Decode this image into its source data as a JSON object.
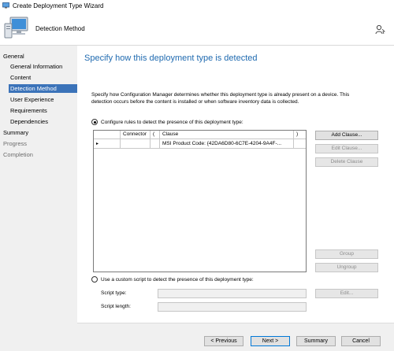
{
  "window": {
    "title": "Create Deployment Type Wizard"
  },
  "header": {
    "title": "Detection Method"
  },
  "nav": {
    "general": "General",
    "general_information": "General Information",
    "content": "Content",
    "detection_method": "Detection Method",
    "user_experience": "User Experience",
    "requirements": "Requirements",
    "dependencies": "Dependencies",
    "summary": "Summary",
    "progress": "Progress",
    "completion": "Completion"
  },
  "main": {
    "heading": "Specify how this deployment type is detected",
    "description": "Specify how Configuration Manager determines whether this deployment type is already present on a device. This detection occurs before the content is installed or when software inventory data is collected.",
    "radio_rules_label": "Configure rules to detect the presence of this deployment type:",
    "radio_script_label": "Use a custom script to detect the presence of this deployment type:",
    "grid": {
      "columns": {
        "connector": "Connector",
        "open_paren": "(",
        "clause": "Clause",
        "close_paren": ")"
      },
      "row": {
        "selector": "▸",
        "connector": "",
        "open_paren": "",
        "clause": "MSI Product Code: {42DA6D80-6C7E-4204-9A4F-...",
        "close_paren": ""
      }
    },
    "buttons": {
      "add_clause": "Add Clause...",
      "edit_clause": "Edit Clause...",
      "delete_clause": "Delete Clause",
      "group": "Group",
      "ungroup": "Ungroup",
      "edit": "Edit..."
    },
    "script_type_label": "Script type:",
    "script_length_label": "Script length:",
    "script_type_value": "",
    "script_length_value": ""
  },
  "footer": {
    "previous": "< Previous",
    "next": "Next >",
    "summary": "Summary",
    "cancel": "Cancel"
  },
  "colors": {
    "accent": "#3b73b9",
    "heading": "#1f6ab0"
  }
}
